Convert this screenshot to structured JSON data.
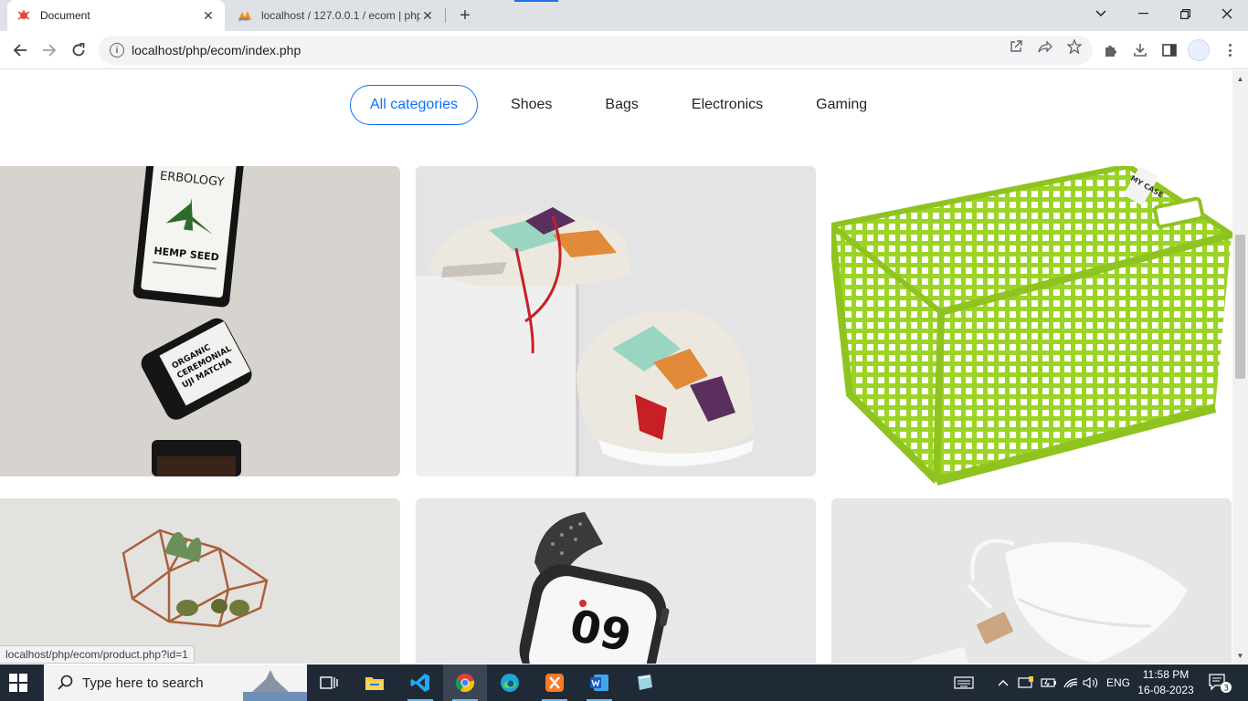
{
  "browser": {
    "tabs": [
      {
        "title": "Document",
        "favicon": "bug-icon",
        "active": true
      },
      {
        "title": "localhost / 127.0.0.1 / ecom | php",
        "favicon": "phpmyadmin-icon",
        "active": false
      }
    ],
    "url": "localhost/php/ecom/index.php",
    "status_url": "localhost/php/ecom/product.php?id=1"
  },
  "page": {
    "categories": [
      {
        "label": "All categories",
        "active": true
      },
      {
        "label": "Shoes",
        "active": false
      },
      {
        "label": "Bags",
        "active": false
      },
      {
        "label": "Electronics",
        "active": false
      },
      {
        "label": "Gaming",
        "active": false
      }
    ],
    "product_images": [
      {
        "subject": "hemp-seed-oil-and-matcha-jars"
      },
      {
        "subject": "sneakers-on-white-blocks"
      },
      {
        "subject": "green-plastic-basket"
      },
      {
        "subject": "geometric-terrarium"
      },
      {
        "subject": "smartwatch"
      },
      {
        "subject": "cotton-drawstring-bag"
      }
    ],
    "image_text": {
      "hemp_brand": "ERBOLOGY",
      "hemp_label": "HEMP SEED",
      "matcha_label": "ORGANIC CEREMONIAL UJI MATCHA",
      "basket_tag": "MY CASE",
      "watch_time": "09"
    }
  },
  "taskbar": {
    "search_placeholder": "Type here to search",
    "language": "ENG",
    "time": "11:58 PM",
    "date": "16-08-2023",
    "notifications": "3"
  },
  "colors": {
    "accent": "#0d6efd",
    "basket": "#9cd426",
    "taskbar": "#202a37"
  }
}
